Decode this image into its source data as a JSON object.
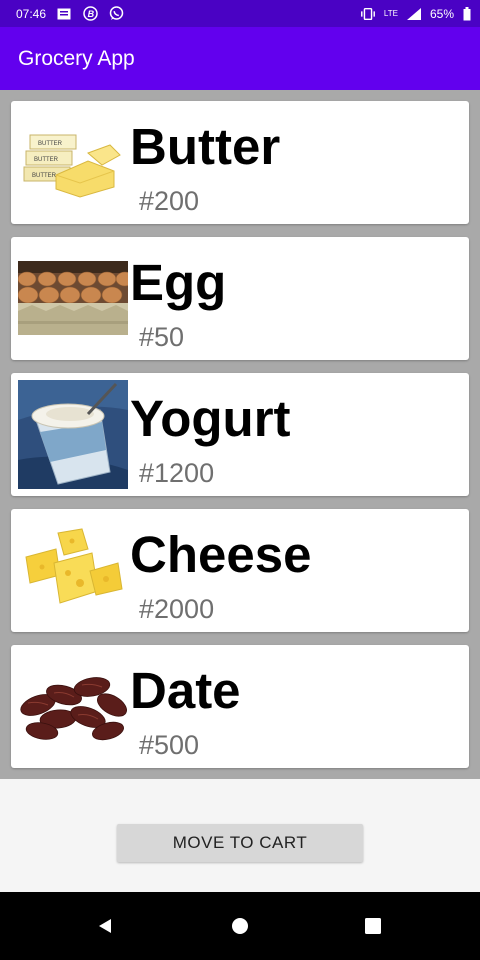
{
  "status_bar": {
    "time": "07:46",
    "network": "LTE",
    "battery": "65%",
    "icons": [
      "message-icon",
      "b-circle-icon",
      "whatsapp-icon",
      "vibrate-icon",
      "lte-icon",
      "signal-icon",
      "battery-icon"
    ]
  },
  "app_bar": {
    "title": "Grocery App"
  },
  "items": [
    {
      "name": "Butter",
      "price": "#200",
      "image": "butter-image"
    },
    {
      "name": "Egg",
      "price": "#50",
      "image": "egg-image"
    },
    {
      "name": "Yogurt",
      "price": "#1200",
      "image": "yogurt-image"
    },
    {
      "name": "Cheese",
      "price": "#2000",
      "image": "cheese-image"
    },
    {
      "name": "Date",
      "price": "#500",
      "image": "date-image"
    }
  ],
  "actions": {
    "move_to_cart": "MOVE TO CART"
  },
  "nav": {
    "icons": [
      "back-icon",
      "home-icon",
      "recents-icon"
    ]
  },
  "colors": {
    "status_bar": "#4a02c4",
    "app_bar": "#6200ee",
    "list_bg": "#a9a9a9",
    "price_text": "#6f6f6f"
  }
}
